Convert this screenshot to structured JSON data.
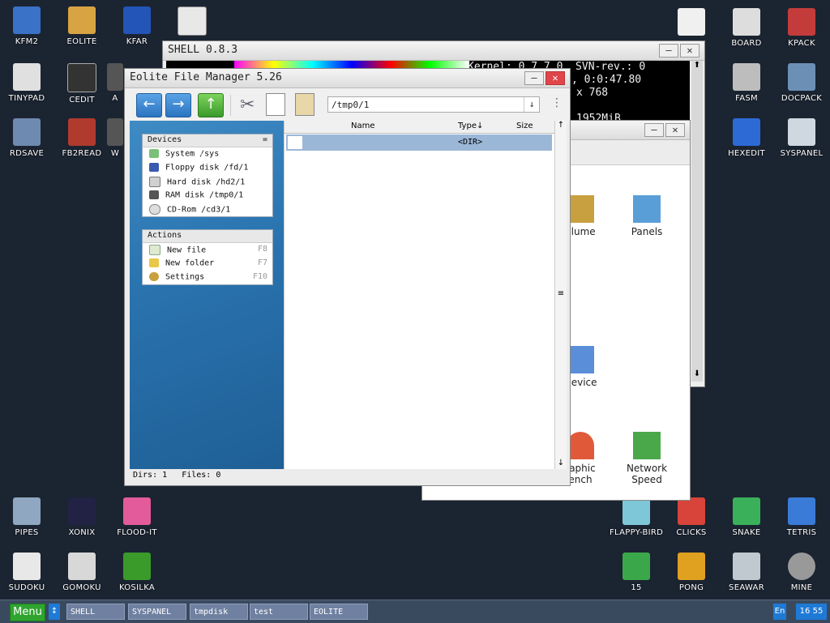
{
  "desktop_left": [
    {
      "label": "KFM2",
      "name": "kfm2-icon",
      "color": "#3a72c8"
    },
    {
      "label": "EOLITE",
      "name": "eolite-icon",
      "color": "#d8a443"
    },
    {
      "label": "KFAR",
      "name": "kfar-icon",
      "color": "#2354b8"
    },
    {
      "label": "TINYPAD",
      "name": "tinypad-icon",
      "color": "#e0e0e0"
    },
    {
      "label": "CEDIT",
      "name": "cedit-icon",
      "color": "#333333"
    },
    {
      "label": "A",
      "name": "a-icon",
      "color": "#555555"
    },
    {
      "label": "RDSAVE",
      "name": "rdsave-icon",
      "color": "#6f8ab0"
    },
    {
      "label": "FB2READ",
      "name": "fb2read-icon",
      "color": "#b03a2e"
    },
    {
      "label": "W",
      "name": "w-icon",
      "color": "#555555"
    }
  ],
  "desktop_right": [
    {
      "label": "BOARD",
      "name": "board-icon",
      "color": "#dddddd"
    },
    {
      "label": "KPACK",
      "name": "kpack-icon",
      "color": "#c43b3b"
    },
    {
      "label": "FASM",
      "name": "fasm-icon",
      "color": "#bdbdbd"
    },
    {
      "label": "DOCPACK",
      "name": "docpack-icon",
      "color": "#6c8fb5"
    },
    {
      "label": "HEXEDIT",
      "name": "hexedit-icon",
      "color": "#2d6ad6"
    },
    {
      "label": "SYSPANEL",
      "name": "syspanel-icon",
      "color": "#cfd8e0"
    }
  ],
  "desktop_bottom": [
    {
      "label": "PIPES",
      "name": "pipes-icon",
      "color": "#8fa7c0"
    },
    {
      "label": "XONIX",
      "name": "xonix-icon",
      "color": "#222244"
    },
    {
      "label": "FLOOD-IT",
      "name": "flood-it-icon",
      "color": "#e35b9a"
    },
    {
      "label": "FLAPPY-BIRD",
      "name": "flappy-bird-icon",
      "color": "#7ec7d8"
    },
    {
      "label": "CLICKS",
      "name": "clicks-icon",
      "color": "#d8443a"
    },
    {
      "label": "SNAKE",
      "name": "snake-icon",
      "color": "#3ab05a"
    },
    {
      "label": "TETRIS",
      "name": "tetris-icon",
      "color": "#3a7bd8"
    },
    {
      "label": "SUDOKU",
      "name": "sudoku-icon",
      "color": "#e8e8e8"
    },
    {
      "label": "GOMOKU",
      "name": "gomoku-icon",
      "color": "#d8d8d8"
    },
    {
      "label": "KOSILKA",
      "name": "kosilka-icon",
      "color": "#3a9a2a"
    },
    {
      "label": "15",
      "name": "fifteen-icon",
      "color": "#3aa84a"
    },
    {
      "label": "PONG",
      "name": "pong-icon",
      "color": "#e0a020"
    },
    {
      "label": "SEAWAR",
      "name": "seawar-icon",
      "color": "#c0c8d0"
    },
    {
      "label": "MINE",
      "name": "mine-icon",
      "color": "#999999"
    }
  ],
  "shell": {
    "title": "SHELL 0.8.3",
    "line1": "Kernel: 0.7.7.0  SVN-rev.: 0",
    "line2": ", 0:0:47.80",
    "line3": "x 768",
    "line4": "1952MiB"
  },
  "syspanel": {
    "items": [
      {
        "label": "olume",
        "name": "volume-icon"
      },
      {
        "label": "Panels",
        "name": "panels-icon"
      },
      {
        "label": "Device",
        "name": "device-icon"
      },
      {
        "label": "raphic\nench",
        "name": "graphic-bench-icon"
      },
      {
        "label": "Network\nSpeed",
        "name": "network-speed-icon"
      }
    ]
  },
  "eolite": {
    "title": "Eolite File Manager 5.26",
    "path": "/tmp0/1",
    "devices_header": "Devices",
    "devices": [
      {
        "label": "System /sys",
        "name": "system-device",
        "icon": "system-icon"
      },
      {
        "label": "Floppy disk /fd/1",
        "name": "floppy-device",
        "icon": "floppy-icon"
      },
      {
        "label": "Hard disk /hd2/1",
        "name": "hard-disk-device",
        "icon": "hard-disk-icon"
      },
      {
        "label": "RAM disk /tmp0/1",
        "name": "ram-disk-device",
        "icon": "ram-icon"
      },
      {
        "label": "CD-Rom /cd3/1",
        "name": "cdrom-device",
        "icon": "cdrom-icon"
      }
    ],
    "actions_header": "Actions",
    "actions": [
      {
        "label": "New file",
        "key": "F8",
        "name": "new-file-action",
        "icon": "new-file-icon"
      },
      {
        "label": "New folder",
        "key": "F7",
        "name": "new-folder-action",
        "icon": "new-folder-icon"
      },
      {
        "label": "Settings",
        "key": "F10",
        "name": "settings-action",
        "icon": "settings-icon"
      }
    ],
    "columns": {
      "name": "Name",
      "type": "Type↓",
      "size": "Size"
    },
    "row_type": "<DIR>",
    "status": "Dirs: 1   Files: 0"
  },
  "taskbar": {
    "menu": "Menu",
    "items": [
      "SHELL",
      "SYSPANEL",
      "tmpdisk",
      "test",
      "EOLITE"
    ],
    "lang": "En",
    "time": "16 55"
  }
}
